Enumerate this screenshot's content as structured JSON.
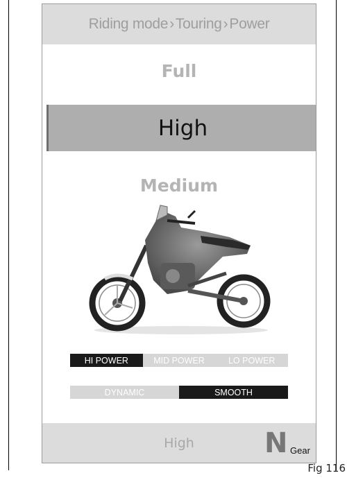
{
  "header": {
    "crumbs": [
      "Riding mode",
      "Touring",
      "Power"
    ],
    "separator": "›"
  },
  "power_list": {
    "above": "Full",
    "selected": "High",
    "below": "Medium"
  },
  "power_levels": [
    {
      "label": "HI POWER",
      "active": true
    },
    {
      "label": "MID POWER",
      "active": false
    },
    {
      "label": "LO POWER",
      "active": false
    }
  ],
  "response_modes": [
    {
      "label": "DYNAMIC",
      "active": false
    },
    {
      "label": "SMOOTH",
      "active": true
    }
  ],
  "footer": {
    "value": "High",
    "gear": "N",
    "gear_label": "Gear"
  },
  "figure_label": "Fig 116"
}
